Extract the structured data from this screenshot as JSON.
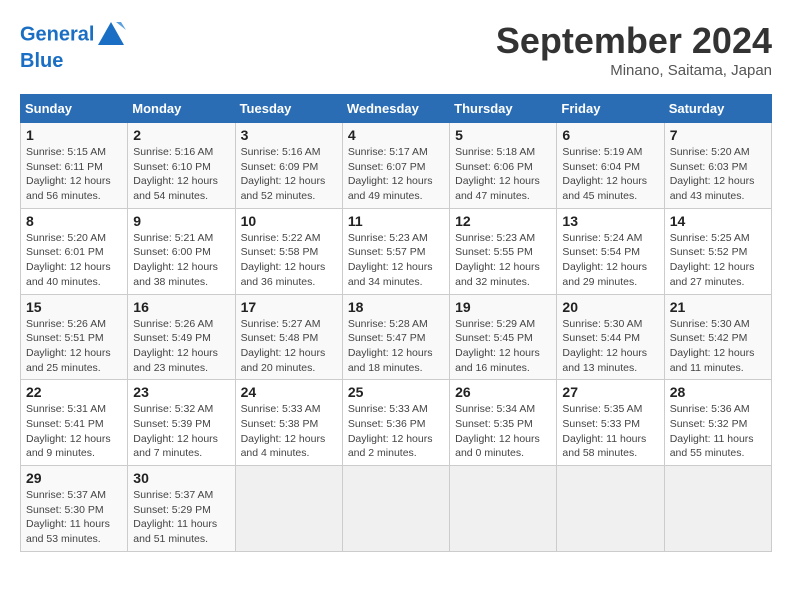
{
  "header": {
    "logo_line1": "General",
    "logo_line2": "Blue",
    "month_title": "September 2024",
    "location": "Minano, Saitama, Japan"
  },
  "calendar": {
    "columns": [
      "Sunday",
      "Monday",
      "Tuesday",
      "Wednesday",
      "Thursday",
      "Friday",
      "Saturday"
    ],
    "weeks": [
      [
        null,
        {
          "day": "2",
          "sunrise": "Sunrise: 5:16 AM",
          "sunset": "Sunset: 6:10 PM",
          "daylight": "Daylight: 12 hours and 54 minutes."
        },
        {
          "day": "3",
          "sunrise": "Sunrise: 5:16 AM",
          "sunset": "Sunset: 6:09 PM",
          "daylight": "Daylight: 12 hours and 52 minutes."
        },
        {
          "day": "4",
          "sunrise": "Sunrise: 5:17 AM",
          "sunset": "Sunset: 6:07 PM",
          "daylight": "Daylight: 12 hours and 49 minutes."
        },
        {
          "day": "5",
          "sunrise": "Sunrise: 5:18 AM",
          "sunset": "Sunset: 6:06 PM",
          "daylight": "Daylight: 12 hours and 47 minutes."
        },
        {
          "day": "6",
          "sunrise": "Sunrise: 5:19 AM",
          "sunset": "Sunset: 6:04 PM",
          "daylight": "Daylight: 12 hours and 45 minutes."
        },
        {
          "day": "7",
          "sunrise": "Sunrise: 5:20 AM",
          "sunset": "Sunset: 6:03 PM",
          "daylight": "Daylight: 12 hours and 43 minutes."
        }
      ],
      [
        {
          "day": "1",
          "sunrise": "Sunrise: 5:15 AM",
          "sunset": "Sunset: 6:11 PM",
          "daylight": "Daylight: 12 hours and 56 minutes."
        },
        null,
        null,
        null,
        null,
        null,
        null
      ],
      [
        {
          "day": "8",
          "sunrise": "Sunrise: 5:20 AM",
          "sunset": "Sunset: 6:01 PM",
          "daylight": "Daylight: 12 hours and 40 minutes."
        },
        {
          "day": "9",
          "sunrise": "Sunrise: 5:21 AM",
          "sunset": "Sunset: 6:00 PM",
          "daylight": "Daylight: 12 hours and 38 minutes."
        },
        {
          "day": "10",
          "sunrise": "Sunrise: 5:22 AM",
          "sunset": "Sunset: 5:58 PM",
          "daylight": "Daylight: 12 hours and 36 minutes."
        },
        {
          "day": "11",
          "sunrise": "Sunrise: 5:23 AM",
          "sunset": "Sunset: 5:57 PM",
          "daylight": "Daylight: 12 hours and 34 minutes."
        },
        {
          "day": "12",
          "sunrise": "Sunrise: 5:23 AM",
          "sunset": "Sunset: 5:55 PM",
          "daylight": "Daylight: 12 hours and 32 minutes."
        },
        {
          "day": "13",
          "sunrise": "Sunrise: 5:24 AM",
          "sunset": "Sunset: 5:54 PM",
          "daylight": "Daylight: 12 hours and 29 minutes."
        },
        {
          "day": "14",
          "sunrise": "Sunrise: 5:25 AM",
          "sunset": "Sunset: 5:52 PM",
          "daylight": "Daylight: 12 hours and 27 minutes."
        }
      ],
      [
        {
          "day": "15",
          "sunrise": "Sunrise: 5:26 AM",
          "sunset": "Sunset: 5:51 PM",
          "daylight": "Daylight: 12 hours and 25 minutes."
        },
        {
          "day": "16",
          "sunrise": "Sunrise: 5:26 AM",
          "sunset": "Sunset: 5:49 PM",
          "daylight": "Daylight: 12 hours and 23 minutes."
        },
        {
          "day": "17",
          "sunrise": "Sunrise: 5:27 AM",
          "sunset": "Sunset: 5:48 PM",
          "daylight": "Daylight: 12 hours and 20 minutes."
        },
        {
          "day": "18",
          "sunrise": "Sunrise: 5:28 AM",
          "sunset": "Sunset: 5:47 PM",
          "daylight": "Daylight: 12 hours and 18 minutes."
        },
        {
          "day": "19",
          "sunrise": "Sunrise: 5:29 AM",
          "sunset": "Sunset: 5:45 PM",
          "daylight": "Daylight: 12 hours and 16 minutes."
        },
        {
          "day": "20",
          "sunrise": "Sunrise: 5:30 AM",
          "sunset": "Sunset: 5:44 PM",
          "daylight": "Daylight: 12 hours and 13 minutes."
        },
        {
          "day": "21",
          "sunrise": "Sunrise: 5:30 AM",
          "sunset": "Sunset: 5:42 PM",
          "daylight": "Daylight: 12 hours and 11 minutes."
        }
      ],
      [
        {
          "day": "22",
          "sunrise": "Sunrise: 5:31 AM",
          "sunset": "Sunset: 5:41 PM",
          "daylight": "Daylight: 12 hours and 9 minutes."
        },
        {
          "day": "23",
          "sunrise": "Sunrise: 5:32 AM",
          "sunset": "Sunset: 5:39 PM",
          "daylight": "Daylight: 12 hours and 7 minutes."
        },
        {
          "day": "24",
          "sunrise": "Sunrise: 5:33 AM",
          "sunset": "Sunset: 5:38 PM",
          "daylight": "Daylight: 12 hours and 4 minutes."
        },
        {
          "day": "25",
          "sunrise": "Sunrise: 5:33 AM",
          "sunset": "Sunset: 5:36 PM",
          "daylight": "Daylight: 12 hours and 2 minutes."
        },
        {
          "day": "26",
          "sunrise": "Sunrise: 5:34 AM",
          "sunset": "Sunset: 5:35 PM",
          "daylight": "Daylight: 12 hours and 0 minutes."
        },
        {
          "day": "27",
          "sunrise": "Sunrise: 5:35 AM",
          "sunset": "Sunset: 5:33 PM",
          "daylight": "Daylight: 11 hours and 58 minutes."
        },
        {
          "day": "28",
          "sunrise": "Sunrise: 5:36 AM",
          "sunset": "Sunset: 5:32 PM",
          "daylight": "Daylight: 11 hours and 55 minutes."
        }
      ],
      [
        {
          "day": "29",
          "sunrise": "Sunrise: 5:37 AM",
          "sunset": "Sunset: 5:30 PM",
          "daylight": "Daylight: 11 hours and 53 minutes."
        },
        {
          "day": "30",
          "sunrise": "Sunrise: 5:37 AM",
          "sunset": "Sunset: 5:29 PM",
          "daylight": "Daylight: 11 hours and 51 minutes."
        },
        null,
        null,
        null,
        null,
        null
      ]
    ]
  }
}
